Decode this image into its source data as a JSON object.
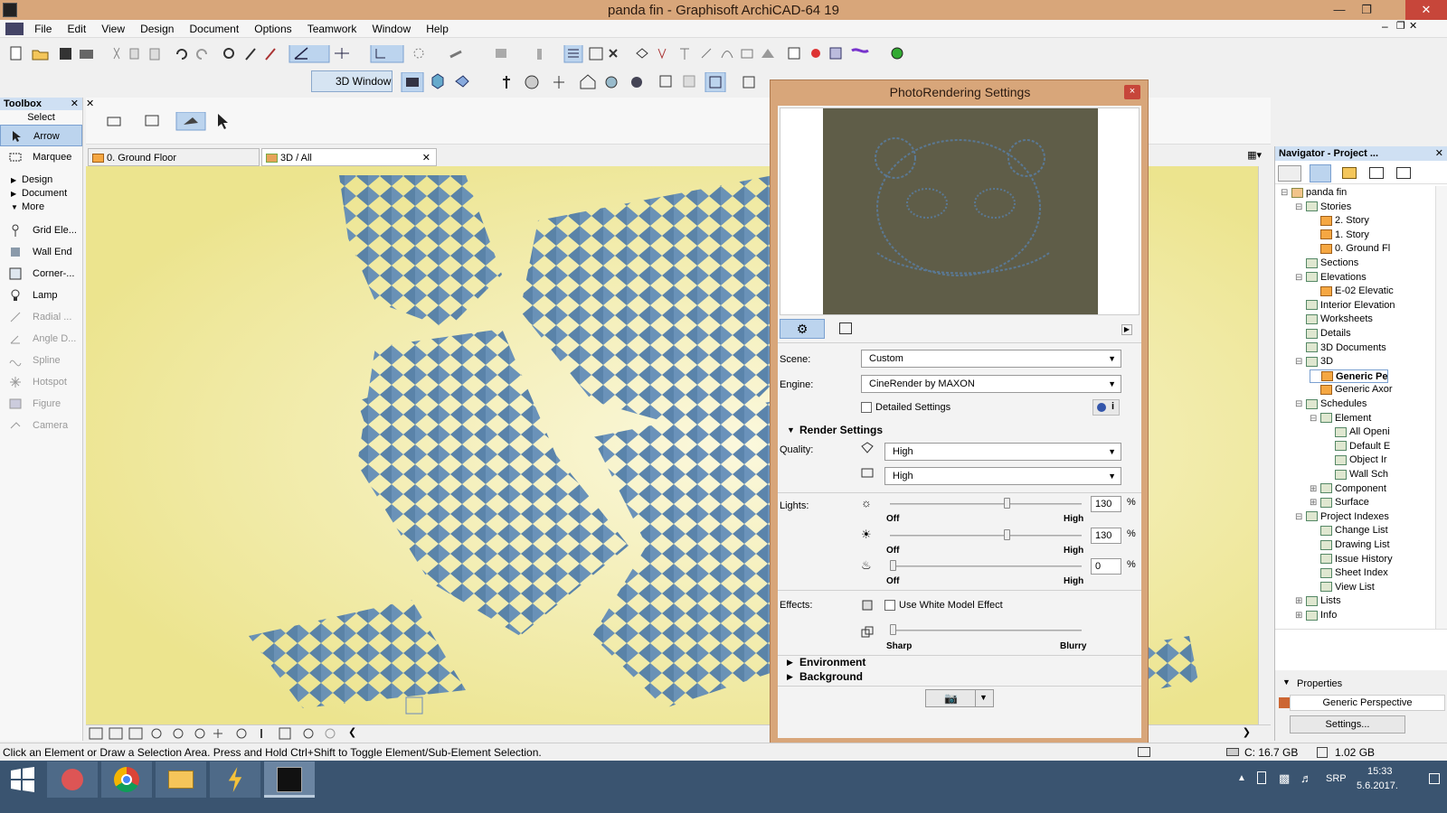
{
  "window": {
    "title": "panda fin - Graphisoft ArchiCAD-64 19"
  },
  "menu": [
    "File",
    "Edit",
    "View",
    "Design",
    "Document",
    "Options",
    "Teamwork",
    "Window",
    "Help"
  ],
  "toolbar": {
    "window_3d_label": "3D Window"
  },
  "toolbox": {
    "title": "Toolbox",
    "select_label": "Select",
    "tools_top": [
      "Arrow",
      "Marquee"
    ],
    "groups": [
      "Design",
      "Document",
      "More"
    ],
    "tools": [
      "Grid Ele...",
      "Wall End",
      "Corner-...",
      "Lamp",
      "Radial ...",
      "Angle D...",
      "Spline",
      "Hotspot",
      "Figure",
      "Camera"
    ]
  },
  "tabs": [
    "0. Ground Floor",
    "3D / All"
  ],
  "navigator": {
    "title": "Navigator - Project ...",
    "properties_label": "Properties",
    "view_name": "Generic Perspective",
    "settings_button": "Settings...",
    "tree": [
      "panda fin",
      "Stories",
      "2. Story",
      "1. Story",
      "0. Ground Fl",
      "Sections",
      "Elevations",
      "E-02 Elevatic",
      "Interior Elevation",
      "Worksheets",
      "Details",
      "3D Documents",
      "3D",
      "Generic Pe",
      "Generic Axor",
      "Schedules",
      "Element",
      "All Openi",
      "Default E",
      "Object Ir",
      "Wall Sch",
      "Component",
      "Surface",
      "Project Indexes",
      "Change List",
      "Drawing List",
      "Issue History",
      "Sheet Index",
      "View List",
      "Lists",
      "Info"
    ]
  },
  "dialog": {
    "title": "PhotoRendering Settings",
    "close_glyph": "×",
    "scene_label": "Scene:",
    "scene_value": "Custom",
    "engine_label": "Engine:",
    "engine_value": "CineRender by MAXON",
    "detailed_settings": "Detailed Settings",
    "render_settings": "Render Settings",
    "quality_label": "Quality:",
    "quality_1": "High",
    "quality_2": "High",
    "lights_label": "Lights:",
    "light_values": [
      "130",
      "130",
      "0"
    ],
    "light_fractions": [
      0.6,
      0.6,
      0.0
    ],
    "percent": "%",
    "off": "Off",
    "high": "High",
    "effects_label": "Effects:",
    "white_model": "Use White Model Effect",
    "sharp": "Sharp",
    "blurry": "Blurry",
    "environment": "Environment",
    "background": "Background"
  },
  "status": {
    "message": "Click an Element or Draw a Selection Area. Press and Hold Ctrl+Shift to Toggle Element/Sub-Element Selection.",
    "disk": "C: 16.7 GB",
    "ram": "1.02 GB"
  },
  "taskbar": {
    "lang": "SRP",
    "time": "15:33",
    "date": "5.6.2017."
  }
}
